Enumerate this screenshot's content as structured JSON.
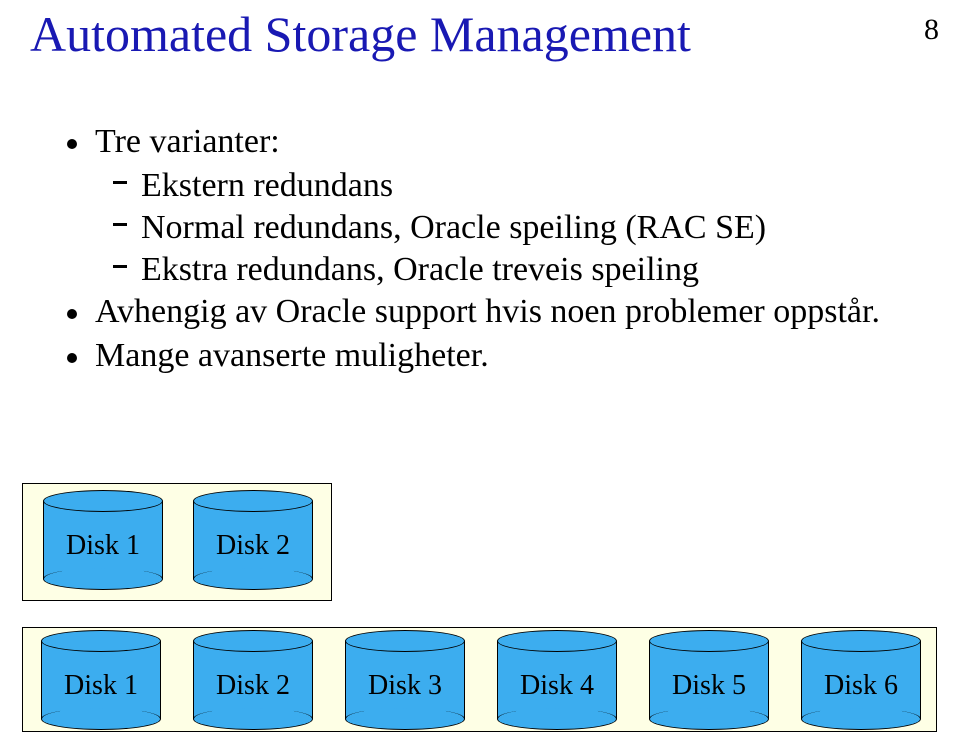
{
  "page_number": "8",
  "title": "Automated Storage Management",
  "bullets": {
    "b1": "Tre varianter:",
    "b1_1": "Ekstern redundans",
    "b1_2": "Normal redundans, Oracle speiling (RAC SE)",
    "b1_3": "Ekstra redundans, Oracle treveis speiling",
    "b2": "Avhengig av Oracle support hvis noen problemer oppstår.",
    "b3": "Mange avanserte muligheter."
  },
  "disks_top": [
    {
      "label": "Disk 1"
    },
    {
      "label": "Disk 2"
    }
  ],
  "disks_bottom": [
    {
      "label": "Disk 1"
    },
    {
      "label": "Disk 2"
    },
    {
      "label": "Disk 3"
    },
    {
      "label": "Disk 4"
    },
    {
      "label": "Disk 5"
    },
    {
      "label": "Disk 6"
    }
  ]
}
